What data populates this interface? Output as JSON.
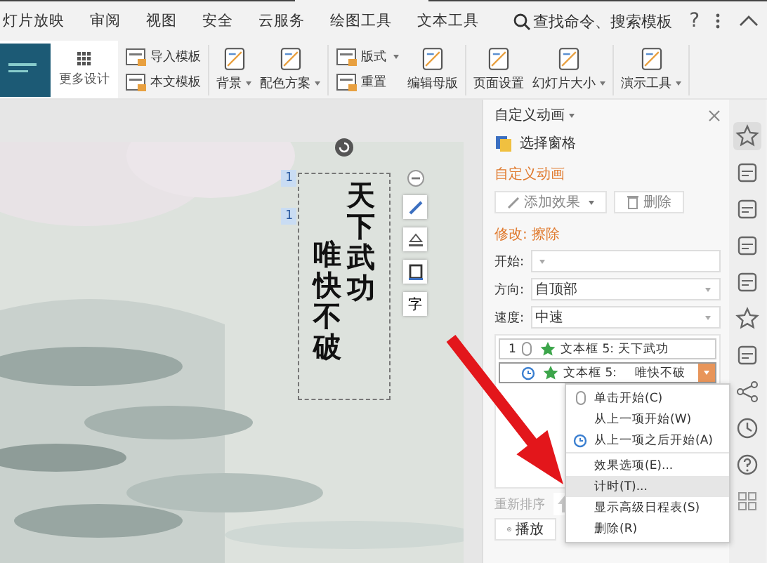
{
  "menu_tabs": [
    {
      "label": "灯片放映",
      "selected": false
    },
    {
      "label": "审阅",
      "selected": false
    },
    {
      "label": "视图",
      "selected": false
    },
    {
      "label": "安全",
      "selected": false
    },
    {
      "label": "云服务",
      "selected": false
    },
    {
      "label": "绘图工具",
      "selected": false
    },
    {
      "label": "文本工具",
      "selected": false
    }
  ],
  "search": {
    "placeholder": "查找命令、搜索模板"
  },
  "help": "?",
  "ribbon": {
    "design": "更多设计",
    "groups": [
      [
        {
          "label": "导入模板",
          "kind": "small"
        },
        {
          "label": "本文模板",
          "kind": "small"
        }
      ],
      [
        {
          "label": "背景",
          "kind": "large",
          "dropdown": true
        },
        {
          "label": "配色方案",
          "kind": "large",
          "dropdown": true
        }
      ],
      [
        {
          "label": "版式",
          "kind": "small",
          "dropdown": true
        },
        {
          "label": "重置",
          "kind": "small",
          "dropdown": false
        },
        {
          "label": "编辑母版",
          "kind": "large",
          "dropdown": false
        }
      ],
      [
        {
          "label": "页面设置",
          "kind": "large",
          "dropdown": false
        },
        {
          "label": "幻灯片大小",
          "kind": "large",
          "dropdown": true
        }
      ],
      [
        {
          "label": "演示工具",
          "kind": "large",
          "dropdown": true
        }
      ]
    ]
  },
  "slide": {
    "kind": "picture",
    "columns": [
      "天下武功",
      "唯快不破"
    ],
    "order_tags": [
      "1",
      "1"
    ],
    "tool_glyph": "字"
  },
  "panel": {
    "title": "自定义动画",
    "selection_pane": "选择窗格",
    "section": "自定义动画",
    "add_effect": "添加效果",
    "delete": "删除",
    "modify": "修改: 擦除",
    "fields": [
      {
        "label": "开始:"
      },
      {
        "label": "方向:",
        "value": "自顶部"
      },
      {
        "label": "速度:",
        "value": "中速"
      }
    ],
    "effects": [
      {
        "order": "1",
        "name": "文本框 5:",
        "text": "天下武功",
        "selected": false
      },
      {
        "name": "文本框 5:",
        "text": "唯快不破",
        "selected": true
      }
    ],
    "reorder": "重新排序",
    "play": "播放"
  },
  "context_menu": [
    [
      {
        "label": "单击开始(C)",
        "selected": false
      },
      {
        "label": "从上一项开始(W)",
        "selected": false
      },
      {
        "label": "从上一项之后开始(A)",
        "selected": false
      }
    ],
    [
      {
        "label": "效果选项(E)...",
        "selected": false
      },
      {
        "label": "计时(T)...",
        "selected": true
      },
      {
        "label": "显示高级日程表(S)",
        "selected": false
      },
      {
        "label": "删除(R)",
        "selected": false
      }
    ]
  ]
}
